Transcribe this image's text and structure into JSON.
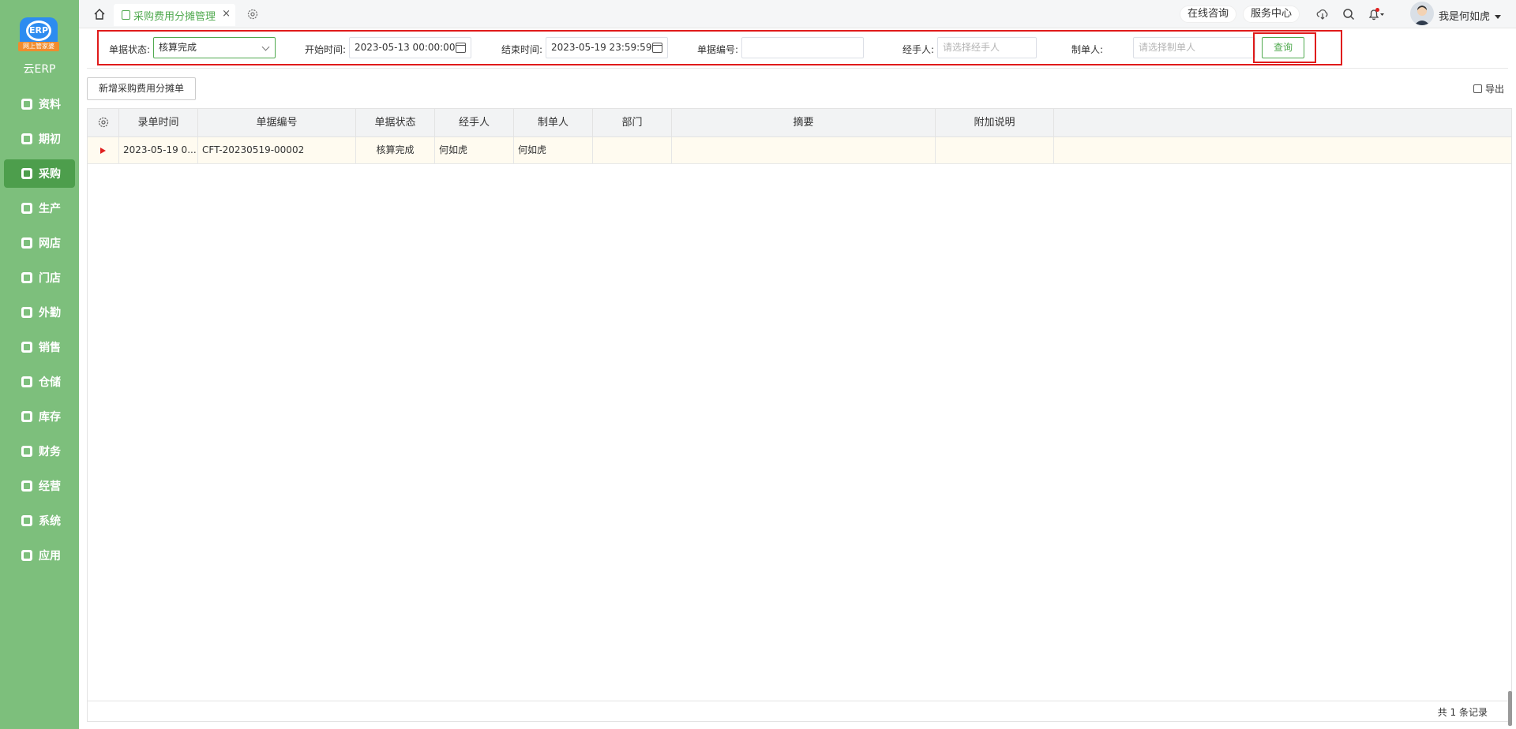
{
  "app": {
    "logo_letters": "ERP",
    "logo_tag": "网上管家婆",
    "name": "云ERP"
  },
  "sidebar": {
    "items": [
      {
        "label": "资料",
        "icon": "document-icon"
      },
      {
        "label": "期初",
        "icon": "target-icon"
      },
      {
        "label": "采购",
        "icon": "purchase-icon",
        "active": true
      },
      {
        "label": "生产",
        "icon": "production-icon"
      },
      {
        "label": "网店",
        "icon": "shop-icon"
      },
      {
        "label": "门店",
        "icon": "pie-icon"
      },
      {
        "label": "外勤",
        "icon": "field-icon"
      },
      {
        "label": "销售",
        "icon": "chart-icon"
      },
      {
        "label": "仓储",
        "icon": "warehouse-icon"
      },
      {
        "label": "库存",
        "icon": "home-store-icon"
      },
      {
        "label": "财务",
        "icon": "finance-icon"
      },
      {
        "label": "经营",
        "icon": "business-icon"
      },
      {
        "label": "系统",
        "icon": "system-icon"
      },
      {
        "label": "应用",
        "icon": "app-icon"
      }
    ]
  },
  "topbar": {
    "tab_label": "采购费用分摊管理",
    "tab_close": "×",
    "consult": "在线咨询",
    "service": "服务中心",
    "username": "我是何如虎"
  },
  "filters": {
    "status_label": "单据状态:",
    "status_value": "核算完成",
    "start_label": "开始时间:",
    "start_value": "2023-05-13 00:00:00",
    "end_label": "结束时间:",
    "end_value": "2023-05-19 23:59:59",
    "number_label": "单据编号:",
    "number_value": "",
    "handler_label": "经手人:",
    "handler_placeholder": "请选择经手人",
    "maker_label": "制单人:",
    "maker_placeholder": "请选择制单人",
    "query_button": "查询"
  },
  "toolbar": {
    "add_button": "新增采购费用分摊单",
    "export": "导出"
  },
  "table": {
    "columns": [
      "录单时间",
      "单据编号",
      "单据状态",
      "经手人",
      "制单人",
      "部门",
      "摘要",
      "附加说明"
    ],
    "rows": [
      {
        "time": "2023-05-19 0...",
        "number": "CFT-20230519-00002",
        "status": "核算完成",
        "handler": "何如虎",
        "maker": "何如虎",
        "dept": "",
        "summary": "",
        "note": ""
      }
    ],
    "total": "共 1 条记录"
  },
  "colors": {
    "sidebar": "#7dbf7c",
    "accent": "#4fa94e",
    "highlight": "#e01b1b"
  }
}
